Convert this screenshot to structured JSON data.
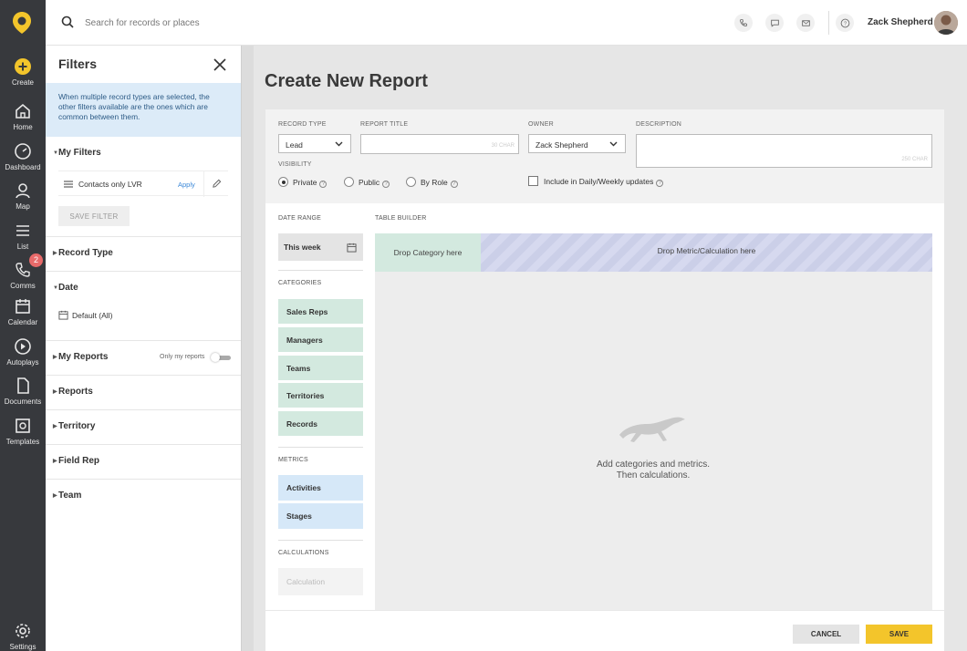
{
  "nav": {
    "items": [
      {
        "label": "Create",
        "icon": "plus-circle-icon"
      },
      {
        "label": "Home",
        "icon": "home-icon"
      },
      {
        "label": "Dashboard",
        "icon": "dashboard-icon"
      },
      {
        "label": "Map",
        "icon": "map-pin-icon"
      },
      {
        "label": "List",
        "icon": "list-icon"
      },
      {
        "label": "Comms",
        "icon": "phone-icon",
        "badge": "2"
      },
      {
        "label": "Calendar",
        "icon": "calendar-icon"
      },
      {
        "label": "Autoplays",
        "icon": "autoplay-icon"
      },
      {
        "label": "Documents",
        "icon": "document-icon"
      },
      {
        "label": "Templates",
        "icon": "templates-icon"
      },
      {
        "label": "Settings",
        "icon": "gear-icon"
      }
    ],
    "accent": "#f3c52b"
  },
  "topbar": {
    "search_placeholder": "Search for records or places",
    "user_name": "Zack Shepherd"
  },
  "filters": {
    "title": "Filters",
    "info": "When multiple record types are selected, the other filters available are the ones which are common between them.",
    "my_filters": "My Filters",
    "saved_filter": {
      "name": "Contacts only LVR",
      "apply": "Apply"
    },
    "save_filter_label": "SAVE FILTER",
    "record_type": "Record Type",
    "date": "Date",
    "date_default": "Default (All)",
    "my_reports": "My Reports",
    "only_my_reports": "Only my reports",
    "reports": "Reports",
    "territory": "Territory",
    "field_rep": "Field Rep",
    "team": "Team"
  },
  "main": {
    "title": "Create New Report",
    "form": {
      "record_type_label": "RECORD TYPE",
      "record_type_value": "Lead",
      "report_title_label": "REPORT TITLE",
      "report_title_value": "",
      "report_title_count": "30 CHAR",
      "owner_label": "OWNER",
      "owner_value": "Zack Shepherd",
      "description_label": "DESCRIPTION",
      "description_count": "250 CHAR",
      "visibility_label": "VISIBILITY",
      "visibility_options": [
        "Private",
        "Public",
        "By Role"
      ],
      "visibility_selected": "Private",
      "include_updates": "Include in Daily/Weekly updates"
    },
    "builder": {
      "date_range_label": "DATE RANGE",
      "date_range_value": "This week",
      "categories_label": "CATEGORIES",
      "categories": [
        "Sales Reps",
        "Managers",
        "Teams",
        "Territories",
        "Records"
      ],
      "metrics_label": "METRICS",
      "metrics": [
        "Activities",
        "Stages"
      ],
      "calculations_label": "CALCULATIONS",
      "calculation_placeholder": "Calculation",
      "table_builder_label": "TABLE BUILDER",
      "drop_category": "Drop Category here",
      "drop_metric": "Drop Metric/Calculation here",
      "empty_line1": "Add categories and metrics.",
      "empty_line2": "Then calculations."
    },
    "footer": {
      "cancel": "CANCEL",
      "save": "SAVE"
    }
  }
}
